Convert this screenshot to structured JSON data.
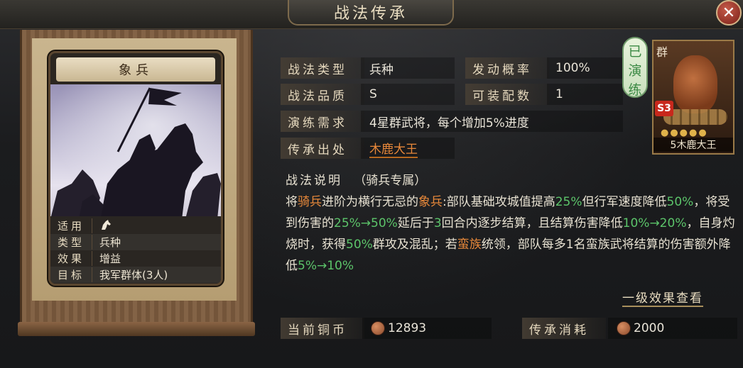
{
  "window": {
    "title": "战法传承",
    "close_label": "✕"
  },
  "card": {
    "name": "象兵",
    "info": [
      {
        "label": "适用",
        "value": ""
      },
      {
        "label": "类型",
        "value": "兵种"
      },
      {
        "label": "效果",
        "value": "增益"
      },
      {
        "label": "目标",
        "value": "我军群体(3人)"
      }
    ]
  },
  "fields": {
    "type_label": "战法类型",
    "type_value": "兵种",
    "rate_label": "发动概率",
    "rate_value": "100%",
    "quality_label": "战法品质",
    "quality_value": "S",
    "equip_label": "可装配数",
    "equip_value": "1",
    "train_label": "演练需求",
    "train_value": "4星群武将，每个增加5%进度",
    "source_label": "传承出处",
    "source_value": "木鹿大王"
  },
  "description": {
    "heading": "战法说明",
    "tag": "（骑兵专属）",
    "segments": [
      {
        "t": "将",
        "c": ""
      },
      {
        "t": "骑兵",
        "c": "orange"
      },
      {
        "t": "进阶为横行无忌的",
        "c": ""
      },
      {
        "t": "象兵",
        "c": "orange"
      },
      {
        "t": ":部队基础攻城值提高",
        "c": ""
      },
      {
        "t": "25%",
        "c": "green"
      },
      {
        "t": "但行军速度降低",
        "c": ""
      },
      {
        "t": "50%",
        "c": "green"
      },
      {
        "t": "，将受到伤害的",
        "c": ""
      },
      {
        "t": "25%→50%",
        "c": "green"
      },
      {
        "t": "延后于",
        "c": ""
      },
      {
        "t": "3",
        "c": "green"
      },
      {
        "t": "回合内逐步结算，且结算伤害降低",
        "c": ""
      },
      {
        "t": "10%→20%",
        "c": "green"
      },
      {
        "t": "，自身灼烧时，获得",
        "c": ""
      },
      {
        "t": "50%",
        "c": "green"
      },
      {
        "t": "群攻及混乱；若",
        "c": ""
      },
      {
        "t": "蛮族",
        "c": "orange"
      },
      {
        "t": "统领，部队每多1名蛮族武将结算的伤害额外降低",
        "c": ""
      },
      {
        "t": "5%→10%",
        "c": "green"
      }
    ],
    "more_link": "一级效果查看"
  },
  "costs": {
    "coins_label": "当前铜币",
    "coins_value": "12893",
    "cost_label": "传承消耗",
    "cost_value": "2000"
  },
  "general": {
    "trained_badge": [
      "已",
      "演",
      "练"
    ],
    "faction": "群",
    "level_badge": "S3",
    "stars": "●●●●●",
    "name": "5木鹿大王"
  },
  "colors": {
    "accent_orange": "#e7883a",
    "accent_green": "#5cc46a"
  }
}
